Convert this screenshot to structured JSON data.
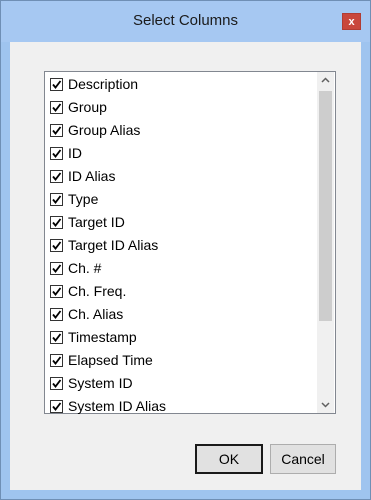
{
  "window": {
    "title": "Select Columns",
    "close_glyph": "x"
  },
  "columns": [
    {
      "label": "Description",
      "checked": true
    },
    {
      "label": "Group",
      "checked": true
    },
    {
      "label": "Group Alias",
      "checked": true
    },
    {
      "label": "ID",
      "checked": true
    },
    {
      "label": "ID Alias",
      "checked": true
    },
    {
      "label": "Type",
      "checked": true
    },
    {
      "label": "Target ID",
      "checked": true
    },
    {
      "label": "Target ID Alias",
      "checked": true
    },
    {
      "label": "Ch. #",
      "checked": true
    },
    {
      "label": "Ch. Freq.",
      "checked": true
    },
    {
      "label": "Ch. Alias",
      "checked": true
    },
    {
      "label": "Timestamp",
      "checked": true
    },
    {
      "label": "Elapsed Time",
      "checked": true
    },
    {
      "label": "System ID",
      "checked": true
    },
    {
      "label": "System ID Alias",
      "checked": true
    }
  ],
  "buttons": {
    "ok": "OK",
    "cancel": "Cancel"
  },
  "icons": {
    "close": "close-icon",
    "checkbox": "checkmark-icon",
    "scroll_up": "chevron-up-icon",
    "scroll_down": "chevron-down-icon"
  },
  "colors": {
    "title_bar": "#a6c8f2",
    "close_button": "#c9473c",
    "dialog_background": "#f0f0f0"
  }
}
